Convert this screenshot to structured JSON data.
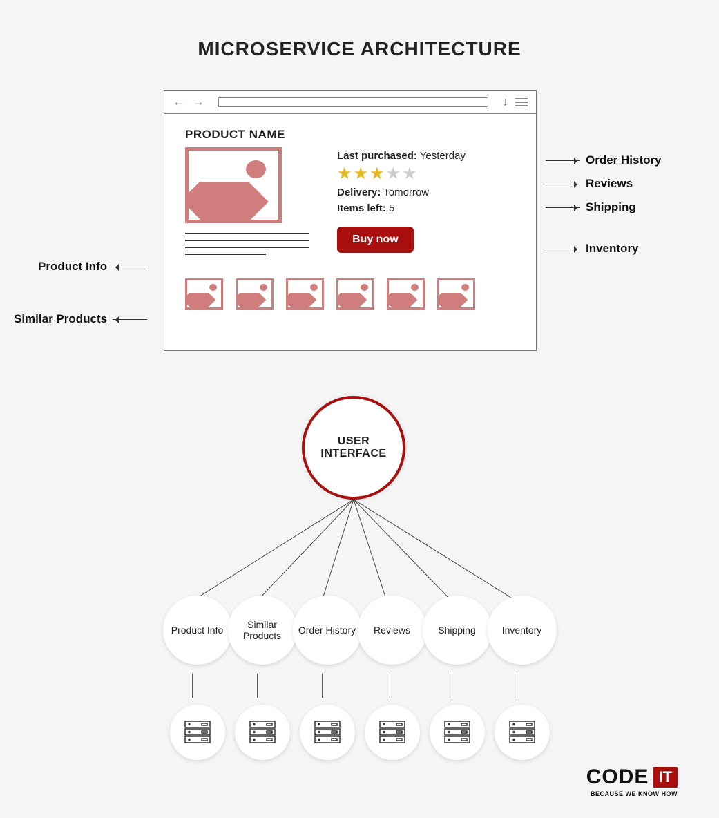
{
  "title": "MICROSERVICE ARCHITECTURE",
  "browser": {
    "product_name": "PRODUCT NAME",
    "last_purchased_label": "Last purchased:",
    "last_purchased_value": "Yesterday",
    "rating": 3,
    "rating_max": 5,
    "delivery_label": "Delivery:",
    "delivery_value": "Tomorrow",
    "items_left_label": "Items left:",
    "items_left_value": "5",
    "buy_button": "Buy now"
  },
  "outer_labels": {
    "order_history": "Order History",
    "reviews": "Reviews",
    "shipping": "Shipping",
    "inventory": "Inventory",
    "product_info": "Product Info",
    "similar_products": "Similar Products"
  },
  "ui_circle": "USER INTERFACE",
  "services": [
    "Product Info",
    "Similar Products",
    "Order History",
    "Reviews",
    "Shipping",
    "Inventory"
  ],
  "logo": {
    "code": "CODE",
    "it": "IT",
    "tagline": "BECAUSE WE KNOW HOW"
  }
}
